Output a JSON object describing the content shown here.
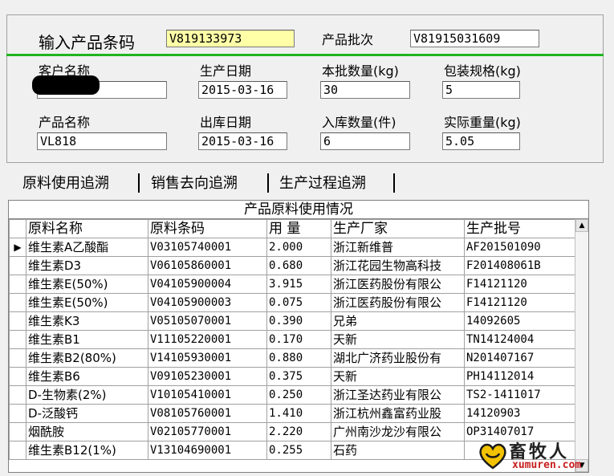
{
  "form": {
    "barcode_label": "输入产品条码",
    "barcode_value": "V819133973",
    "batch_label": "产品批次",
    "batch_value": "V81915031609",
    "customer_label": "客户名称",
    "customer_value": "",
    "prod_date_label": "生产日期",
    "prod_date_value": "2015-03-16",
    "qty_label": "本批数量(kg)",
    "qty_value": "30",
    "pack_label": "包装规格(kg)",
    "pack_value": "5",
    "product_name_label": "产品名称",
    "product_name_value": "VL818",
    "out_date_label": "出库日期",
    "out_date_value": "2015-03-16",
    "in_qty_label": "入库数量(件)",
    "in_qty_value": "6",
    "weight_label": "实际重量(kg)",
    "weight_value": "5.05"
  },
  "tabs": [
    {
      "label": "原料使用追溯"
    },
    {
      "label": "销售去向追溯"
    },
    {
      "label": "生产过程追溯"
    }
  ],
  "grid": {
    "caption": "产品原料使用情况",
    "columns": [
      "原料名称",
      "原料条码",
      "用 量",
      "生产厂家",
      "生产批号"
    ],
    "rows": [
      {
        "name": "维生素A乙酸酯",
        "code": "V03105740001",
        "amount": "2.000",
        "maker": "浙江新维普",
        "batch": "AF201501090"
      },
      {
        "name": "维生素D3",
        "code": "V06105860001",
        "amount": "0.680",
        "maker": "浙江花园生物高科技",
        "batch": "F201408061B"
      },
      {
        "name": "维生素E(50%)",
        "code": "V04105900004",
        "amount": "3.915",
        "maker": "浙江医药股份有限公",
        "batch": "F14121120"
      },
      {
        "name": "维生素E(50%)",
        "code": "V04105900003",
        "amount": "0.075",
        "maker": "浙江医药股份有限公",
        "batch": "F14121120"
      },
      {
        "name": "维生素K3",
        "code": "V05105070001",
        "amount": "0.390",
        "maker": "兄弟",
        "batch": "14092605"
      },
      {
        "name": "维生素B1",
        "code": "V11105220001",
        "amount": "0.170",
        "maker": "天新",
        "batch": "TN14124004"
      },
      {
        "name": "维生素B2(80%)",
        "code": "V14105930001",
        "amount": "0.880",
        "maker": "湖北广济药业股份有",
        "batch": "N201407167"
      },
      {
        "name": "维生素B6",
        "code": "V09105230001",
        "amount": "0.375",
        "maker": "天新",
        "batch": "PH14112014"
      },
      {
        "name": "D-生物素(2%)",
        "code": "V10105410001",
        "amount": "0.250",
        "maker": "浙江圣达药业有限公",
        "batch": "TS2-1411017"
      },
      {
        "name": "D-泛酸钙",
        "code": "V08105760001",
        "amount": "1.410",
        "maker": "浙江杭州鑫富药业股",
        "batch": "14120903"
      },
      {
        "name": "烟酰胺",
        "code": "V02105770001",
        "amount": "2.220",
        "maker": "广州南沙龙沙有限公",
        "batch": "OP31407017"
      },
      {
        "name": "维生素B12(1%)",
        "code": "V13104690001",
        "amount": "0.255",
        "maker": "石药",
        "batch": ""
      }
    ]
  },
  "watermark": {
    "name": "畜牧人",
    "domain": "xumuren.com",
    "icon": "heart-logo-icon"
  }
}
